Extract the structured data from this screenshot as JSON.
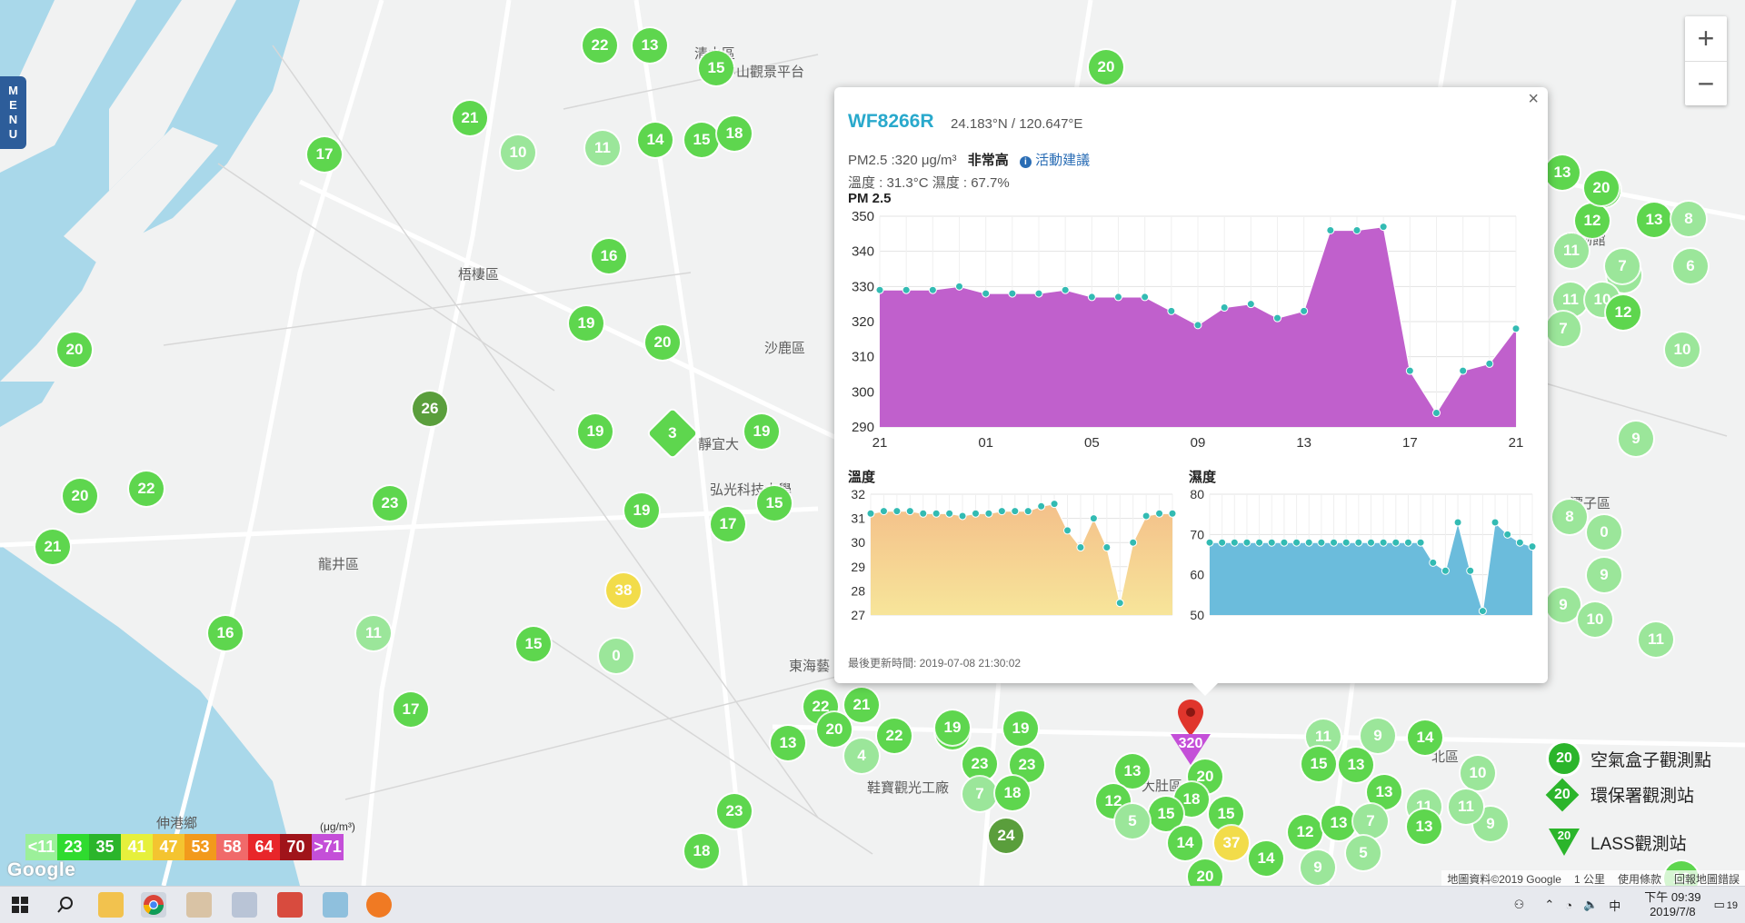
{
  "map": {
    "places": [
      "梧棲區",
      "沙鹿區",
      "龍井區",
      "靜宜大",
      "弘光科技大學",
      "東海藝",
      "伸港鄉",
      "鞋寶觀光工廠",
      "大肚區",
      "潭子區",
      "博物館",
      "北區",
      "中山觀景平台",
      "清水區"
    ],
    "markers": [
      {
        "v": "22",
        "c": "#5ed64e"
      },
      {
        "v": "13",
        "c": "#5ed64e"
      },
      {
        "v": "15",
        "c": "#5ed64e"
      },
      {
        "v": "20",
        "c": "#5ed64e"
      },
      {
        "v": "21",
        "c": "#5ed64e"
      },
      {
        "v": "17",
        "c": "#5ed64e"
      },
      {
        "v": "10",
        "c": "#9be69a"
      },
      {
        "v": "11",
        "c": "#9be69a"
      },
      {
        "v": "14",
        "c": "#5ed64e"
      },
      {
        "v": "15",
        "c": "#5ed64e"
      },
      {
        "v": "18",
        "c": "#5ed64e"
      },
      {
        "v": "16",
        "c": "#5ed64e"
      },
      {
        "v": "19",
        "c": "#5ed64e"
      },
      {
        "v": "20",
        "c": "#5ed64e"
      },
      {
        "v": "20",
        "c": "#5ed64e"
      },
      {
        "v": "26",
        "c": "#5a9e3c"
      },
      {
        "v": "19",
        "c": "#5ed64e"
      },
      {
        "v": "3",
        "c": "#5ed64e"
      },
      {
        "v": "19",
        "c": "#5ed64e"
      },
      {
        "v": "20",
        "c": "#5ed64e"
      },
      {
        "v": "22",
        "c": "#5ed64e"
      },
      {
        "v": "23",
        "c": "#5ed64e"
      },
      {
        "v": "19",
        "c": "#5ed64e"
      },
      {
        "v": "17",
        "c": "#5ed64e"
      },
      {
        "v": "15",
        "c": "#5ed64e"
      },
      {
        "v": "21",
        "c": "#5ed64e"
      },
      {
        "v": "38",
        "c": "#f2dc4a"
      },
      {
        "v": "16",
        "c": "#5ed64e"
      },
      {
        "v": "11",
        "c": "#9be69a"
      },
      {
        "v": "15",
        "c": "#5ed64e"
      },
      {
        "v": "0",
        "c": "#9be69a"
      },
      {
        "v": "17",
        "c": "#5ed64e"
      },
      {
        "v": "22",
        "c": "#5ed64e"
      },
      {
        "v": "21",
        "c": "#5ed64e"
      },
      {
        "v": "20",
        "c": "#5ed64e"
      },
      {
        "v": "13",
        "c": "#5ed64e"
      },
      {
        "v": "22",
        "c": "#5ed64e"
      },
      {
        "v": "4",
        "c": "#9be69a"
      },
      {
        "v": "23",
        "c": "#5ed64e"
      },
      {
        "v": "15",
        "c": "#5ed64e"
      },
      {
        "v": "19",
        "c": "#5ed64e"
      },
      {
        "v": "19",
        "c": "#5ed64e"
      },
      {
        "v": "23",
        "c": "#5ed64e"
      },
      {
        "v": "7",
        "c": "#9be69a"
      },
      {
        "v": "18",
        "c": "#5ed64e"
      },
      {
        "v": "24",
        "c": "#5a9e3c"
      },
      {
        "v": "23",
        "c": "#5ed64e"
      },
      {
        "v": "18",
        "c": "#5ed64e"
      },
      {
        "v": "13",
        "c": "#5ed64e"
      },
      {
        "v": "20",
        "c": "#5ed64e"
      },
      {
        "v": "12",
        "c": "#5ed64e"
      },
      {
        "v": "18",
        "c": "#5ed64e"
      },
      {
        "v": "15",
        "c": "#5ed64e"
      },
      {
        "v": "15",
        "c": "#5ed64e"
      },
      {
        "v": "5",
        "c": "#9be69a"
      },
      {
        "v": "14",
        "c": "#5ed64e"
      },
      {
        "v": "37",
        "c": "#f2dc4a"
      },
      {
        "v": "14",
        "c": "#5ed64e"
      },
      {
        "v": "20",
        "c": "#5ed64e"
      },
      {
        "v": "11",
        "c": "#9be69a"
      },
      {
        "v": "9",
        "c": "#9be69a"
      },
      {
        "v": "15",
        "c": "#5ed64e"
      },
      {
        "v": "13",
        "c": "#5ed64e"
      },
      {
        "v": "13",
        "c": "#5ed64e"
      },
      {
        "v": "12",
        "c": "#5ed64e"
      },
      {
        "v": "13",
        "c": "#5ed64e"
      },
      {
        "v": "7",
        "c": "#9be69a"
      },
      {
        "v": "9",
        "c": "#9be69a"
      },
      {
        "v": "11",
        "c": "#9be69a"
      },
      {
        "v": "14",
        "c": "#5ed64e"
      },
      {
        "v": "10",
        "c": "#9be69a"
      },
      {
        "v": "13",
        "c": "#5ed64e"
      },
      {
        "v": "12",
        "c": "#5ed64e"
      },
      {
        "v": "11",
        "c": "#9be69a"
      },
      {
        "v": "13",
        "c": "#5ed64e"
      },
      {
        "v": "10",
        "c": "#9be69a"
      },
      {
        "v": "7",
        "c": "#9be69a"
      },
      {
        "v": "8",
        "c": "#9be69a"
      },
      {
        "v": "6",
        "c": "#9be69a"
      },
      {
        "v": "11",
        "c": "#9be69a"
      },
      {
        "v": "10",
        "c": "#9be69a"
      },
      {
        "v": "7",
        "c": "#9be69a"
      },
      {
        "v": "12",
        "c": "#5ed64e"
      },
      {
        "v": "10",
        "c": "#9be69a"
      },
      {
        "v": "9",
        "c": "#9be69a"
      },
      {
        "v": "8",
        "c": "#9be69a"
      },
      {
        "v": "0",
        "c": "#9be69a"
      },
      {
        "v": "9",
        "c": "#9be69a"
      },
      {
        "v": "9",
        "c": "#9be69a"
      },
      {
        "v": "10",
        "c": "#9be69a"
      },
      {
        "v": "11",
        "c": "#9be69a"
      },
      {
        "v": "13",
        "c": "#5ed64e"
      },
      {
        "v": "20",
        "c": "#5ed64e"
      },
      {
        "v": "12",
        "c": "#5ed64e"
      },
      {
        "v": "9",
        "c": "#9be69a"
      },
      {
        "v": "11",
        "c": "#9be69a"
      },
      {
        "v": "13",
        "c": "#5ed64e"
      },
      {
        "v": "5",
        "c": "#9be69a"
      }
    ],
    "selected_value": "320",
    "selected_color": "#c44fd8"
  },
  "menu": {
    "label": "MENU"
  },
  "zoom": {
    "in": "+",
    "out": "−"
  },
  "popup": {
    "close": "×",
    "station": "WF8266R",
    "coords": "24.183°N / 120.647°E",
    "pm_text": "PM2.5 :320 μg/m³",
    "level": "非常高",
    "advice": "活動建議",
    "temp_text": "溫度 : 31.3°C 濕度 : 67.7%",
    "updated": "最後更新時間: 2019-07-08 21:30:02"
  },
  "legend": {
    "unit": "(μg/m³)",
    "items": [
      {
        "label": "<11",
        "color": "#9cf09a"
      },
      {
        "label": "23",
        "color": "#2fdb2f"
      },
      {
        "label": "35",
        "color": "#2bb52b"
      },
      {
        "label": "41",
        "color": "#e6f03c"
      },
      {
        "label": "47",
        "color": "#f4c430"
      },
      {
        "label": "53",
        "color": "#f29a1c"
      },
      {
        "label": "58",
        "color": "#f06a6a"
      },
      {
        "label": "64",
        "color": "#e8262a"
      },
      {
        "label": "70",
        "color": "#a0141a"
      },
      {
        "label": ">71",
        "color": "#c44fd8"
      }
    ]
  },
  "map_key": {
    "box": {
      "label": "空氣盒子觀測點",
      "value": "20"
    },
    "epa": {
      "label": "環保署觀測站",
      "value": "20"
    },
    "lass": {
      "label": "LASS觀測站",
      "value": "20"
    }
  },
  "google_logo": "Google",
  "attribution": {
    "data": "地圖資料©2019 Google",
    "scale": "1 公里",
    "terms": "使用條款",
    "report": "回報地圖錯誤"
  },
  "taskbar": {
    "time": "下午 09:39",
    "date": "2019/7/8",
    "ime": "中",
    "notif": "19"
  },
  "chart_data": [
    {
      "type": "area",
      "title": "PM 2.5",
      "x_ticks": [
        "21",
        "01",
        "05",
        "09",
        "13",
        "17",
        "21"
      ],
      "ylim": [
        290,
        350
      ],
      "y_ticks": [
        290,
        300,
        310,
        320,
        330,
        340,
        350
      ],
      "values": [
        329,
        329,
        329,
        330,
        328,
        328,
        328,
        329,
        327,
        327,
        327,
        323,
        319,
        324,
        325,
        321,
        323,
        346,
        346,
        347,
        306,
        294,
        306,
        308,
        318
      ],
      "color": "#c060cc",
      "point_color": "#33bbb3"
    },
    {
      "type": "area",
      "title": "溫度",
      "ylim": [
        27,
        32
      ],
      "y_ticks": [
        27,
        28,
        29,
        30,
        31,
        32
      ],
      "values": [
        31.2,
        31.3,
        31.3,
        31.3,
        31.2,
        31.2,
        31.2,
        31.1,
        31.2,
        31.2,
        31.3,
        31.3,
        31.3,
        31.5,
        31.6,
        30.5,
        29.8,
        31.0,
        29.8,
        27.5,
        30.0,
        31.1,
        31.2,
        31.2
      ],
      "color_top": "#f4c08a",
      "color_bottom": "#f7e59a",
      "point_color": "#33bbb3"
    },
    {
      "type": "area",
      "title": "濕度",
      "ylim": [
        50,
        80
      ],
      "y_ticks": [
        50,
        60,
        70,
        80
      ],
      "values": [
        68,
        68,
        68,
        68,
        68,
        68,
        68,
        68,
        68,
        68,
        68,
        68,
        68,
        68,
        68,
        68,
        68,
        68,
        63,
        61,
        73,
        61,
        51,
        73,
        70,
        68,
        67
      ],
      "color": "#6bbcdc",
      "point_color": "#33bbb3"
    }
  ]
}
